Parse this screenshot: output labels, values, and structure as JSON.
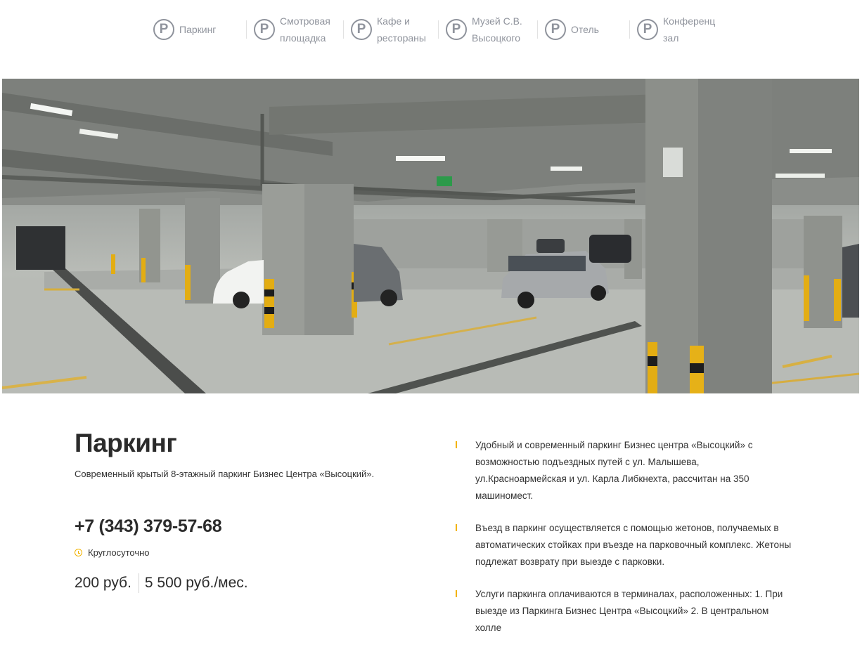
{
  "nav": {
    "items": [
      {
        "icon": "parking-icon",
        "glyph": "P",
        "label": "Паркинг"
      },
      {
        "icon": "parking-icon",
        "glyph": "P",
        "label": "Смотровая площадка"
      },
      {
        "icon": "parking-icon",
        "glyph": "P",
        "label": "Кафе и рестораны"
      },
      {
        "icon": "parking-icon",
        "glyph": "P",
        "label": "Музей С.В. Высоцкого"
      },
      {
        "icon": "parking-icon",
        "glyph": "P",
        "label": "Отель"
      },
      {
        "icon": "parking-icon",
        "glyph": "P",
        "label": "Конференц зал"
      }
    ]
  },
  "hero": {
    "image": "underground-parking-photo"
  },
  "main": {
    "title": "Паркинг",
    "subtitle": "Современный крытый 8-этажный паркинг Бизнес Центра «Высоцкий».",
    "phone": "+7 (343) 379-57-68",
    "hours": "Круглосуточно",
    "price_hour": "200 руб.",
    "price_month": "5 500 руб./мес."
  },
  "features": [
    "Удобный и современный паркинг Бизнес центра «Высоцкий» с возможностью подъездных путей с ул. Малышева, ул.Красноармейская и ул. Карла Либкнехта, рассчитан на 350 машиномест.",
    "Въезд в паркинг осуществляется с помощью жетонов, получаемых в автоматических стойках при въезде на парковочный комплекс. Жетоны подлежат возврату при выезде с парковки.",
    "Услуги паркинга оплачиваются в терминалах, расположенных: 1. При выезде из Паркинга Бизнес Центра «Высоцкий» 2. В центральном холле"
  ],
  "colors": {
    "accent": "#f2b300",
    "nav_gray": "#8f939c",
    "text": "#2b2b2b"
  }
}
